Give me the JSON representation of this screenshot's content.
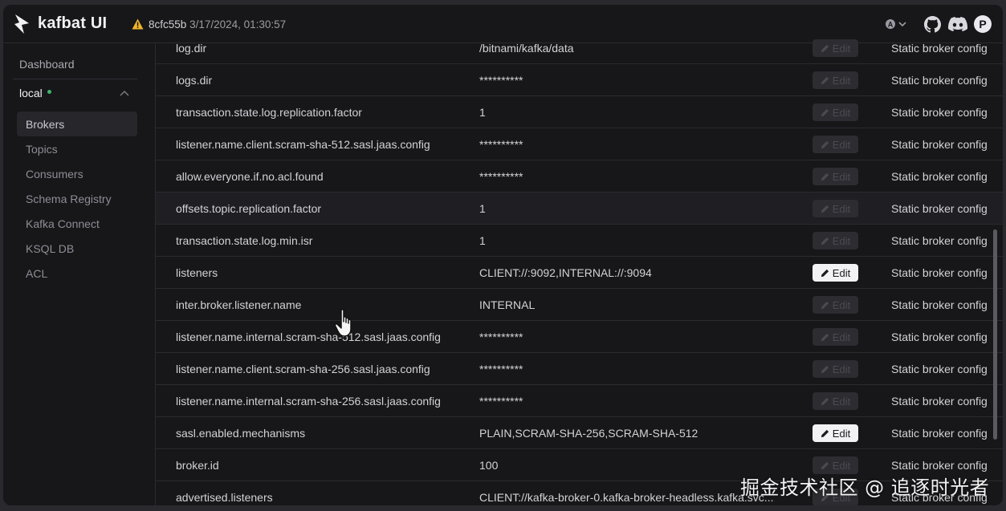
{
  "header": {
    "brand": "kafbat UI",
    "version_sha": "8cfc55b",
    "version_date": "3/17/2024, 01:30:57",
    "icons": [
      "warning-icon",
      "theme-icon",
      "github-icon",
      "discord-icon",
      "user-avatar"
    ],
    "avatar_letter": "P"
  },
  "sidebar": {
    "dashboard": "Dashboard",
    "cluster": "local",
    "items": [
      {
        "label": "Brokers",
        "active": true
      },
      {
        "label": "Topics",
        "active": false
      },
      {
        "label": "Consumers",
        "active": false
      },
      {
        "label": "Schema Registry",
        "active": false
      },
      {
        "label": "Kafka Connect",
        "active": false
      },
      {
        "label": "KSQL DB",
        "active": false
      },
      {
        "label": "ACL",
        "active": false
      }
    ]
  },
  "table": {
    "edit_label": "Edit",
    "rows": [
      {
        "key": "log.dir",
        "value": "/bitnami/kafka/data",
        "source": "Static broker config",
        "editable": false
      },
      {
        "key": "logs.dir",
        "value": "**********",
        "source": "Static broker config",
        "editable": false
      },
      {
        "key": "transaction.state.log.replication.factor",
        "value": "1",
        "source": "Static broker config",
        "editable": false
      },
      {
        "key": "listener.name.client.scram-sha-512.sasl.jaas.config",
        "value": "**********",
        "source": "Static broker config",
        "editable": false
      },
      {
        "key": "allow.everyone.if.no.acl.found",
        "value": "**********",
        "source": "Static broker config",
        "editable": false
      },
      {
        "key": "offsets.topic.replication.factor",
        "value": "1",
        "source": "Static broker config",
        "editable": false
      },
      {
        "key": "transaction.state.log.min.isr",
        "value": "1",
        "source": "Static broker config",
        "editable": false
      },
      {
        "key": "listeners",
        "value": "CLIENT://:9092,INTERNAL://:9094",
        "source": "Static broker config",
        "editable": true
      },
      {
        "key": "inter.broker.listener.name",
        "value": "INTERNAL",
        "source": "Static broker config",
        "editable": false
      },
      {
        "key": "listener.name.internal.scram-sha-512.sasl.jaas.config",
        "value": "**********",
        "source": "Static broker config",
        "editable": false
      },
      {
        "key": "listener.name.client.scram-sha-256.sasl.jaas.config",
        "value": "**********",
        "source": "Static broker config",
        "editable": false
      },
      {
        "key": "listener.name.internal.scram-sha-256.sasl.jaas.config",
        "value": "**********",
        "source": "Static broker config",
        "editable": false
      },
      {
        "key": "sasl.enabled.mechanisms",
        "value": "PLAIN,SCRAM-SHA-256,SCRAM-SHA-512",
        "source": "Static broker config",
        "editable": true
      },
      {
        "key": "broker.id",
        "value": "100",
        "source": "Static broker config",
        "editable": false
      },
      {
        "key": "advertised.listeners",
        "value": "CLIENT://kafka-broker-0.kafka-broker-headless.kafka.svc...",
        "source": "Static broker config",
        "editable": false
      }
    ]
  },
  "watermark": "掘金技术社区 @ 追逐时光者"
}
